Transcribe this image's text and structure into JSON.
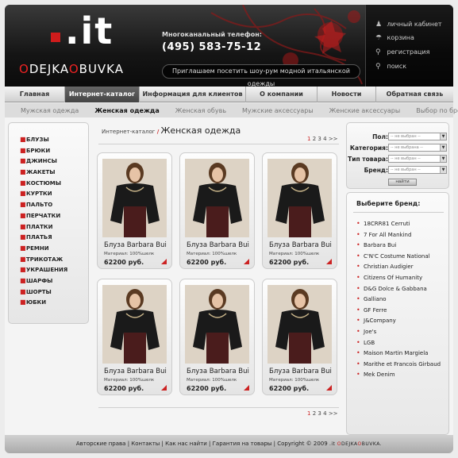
{
  "header": {
    "logo_mark": ".it",
    "logo_name_parts": [
      "",
      "O",
      "DEJKA",
      "O",
      "BUVKA"
    ],
    "phone_label": "Многоканальный телефон:",
    "phone": "(495) 583-75-12",
    "promo": "Приглашаем посетить шоу-рум модной итальянской одежды",
    "side_menu": [
      {
        "label": "личный кабинет",
        "icon": "users-icon"
      },
      {
        "label": "корзина",
        "icon": "basket-icon"
      },
      {
        "label": "регистрация",
        "icon": "key-icon"
      },
      {
        "label": "поиск",
        "icon": "search-icon"
      }
    ]
  },
  "main_nav": [
    {
      "label": "Главная",
      "active": false
    },
    {
      "label": "Интернет-каталог",
      "active": true
    },
    {
      "label": "Информация для клиентов",
      "active": false
    },
    {
      "label": "О компании",
      "active": false
    },
    {
      "label": "Новости",
      "active": false
    },
    {
      "label": "Обратная связь",
      "active": false
    }
  ],
  "sub_nav": [
    {
      "label": "Мужская одежда",
      "active": false
    },
    {
      "label": "Женская одежда",
      "active": true
    },
    {
      "label": "Женская обувь",
      "active": false
    },
    {
      "label": "Мужские аксессуары",
      "active": false
    },
    {
      "label": "Женские аксессуары",
      "active": false
    },
    {
      "label": "Выбор по бренду",
      "active": false
    }
  ],
  "categories": [
    "БЛУЗЫ",
    "БРЮКИ",
    "ДЖИНСЫ",
    "ЖАКЕТЫ",
    "КОСТЮМЫ",
    "КУРТКИ",
    "ПАЛЬТО",
    "ПЕРЧАТКИ",
    "ПЛАТКИ",
    "ПЛАТЬЯ",
    "РЕМНИ",
    "ТРИКОТАЖ",
    "УКРАШЕНИЯ",
    "ШАРФЫ",
    "ШОРТЫ",
    "ЮБКИ"
  ],
  "breadcrumb": {
    "root": "Интернет-каталог",
    "separator": "/",
    "title": "Женская одежда"
  },
  "pager": {
    "pages": [
      "1",
      "2",
      "3",
      "4"
    ],
    "current": "1",
    "next": ">>"
  },
  "products": [
    {
      "title": "Блуза Barbara Bui",
      "material": "Материал: 100%шелк",
      "price": "62200 руб."
    },
    {
      "title": "Блуза Barbara Bui",
      "material": "Материал: 100%шелк",
      "price": "62200 руб."
    },
    {
      "title": "Блуза Barbara Bui",
      "material": "Материал: 100%шелк",
      "price": "62200 руб."
    },
    {
      "title": "Блуза Barbara Bui",
      "material": "Материал: 100%шелк",
      "price": "62200 руб."
    },
    {
      "title": "Блуза Barbara Bui",
      "material": "Материал: 100%шелк",
      "price": "62200 руб."
    },
    {
      "title": "Блуза Barbara Bui",
      "material": "Материал: 100%шелк",
      "price": "62200 руб."
    }
  ],
  "filter": {
    "fields": [
      {
        "label": "Пол:",
        "value": "-- не выбран --"
      },
      {
        "label": "Категория:",
        "value": "-- не выбрана --"
      },
      {
        "label": "Тип товара:",
        "value": "-- не выбран --"
      },
      {
        "label": "Бренд:",
        "value": "-- не выбран --"
      }
    ],
    "button": "найти"
  },
  "brands": {
    "title": "Выберите бренд:",
    "items": [
      "18CRR81 Cerruti",
      "7 For All Mankind",
      "Barbara Bui",
      "C'N'C Costume National",
      "Christian Audigier",
      "Citizens Of Humanity",
      "D&G Dolce & Gabbana",
      "Galliano",
      "GF Ferre",
      "J&Company",
      "Joe's",
      "LGB",
      "Maison Martin Margiela",
      "Marithe et Francois Girbaud",
      "Mek Denim"
    ]
  },
  "footer": {
    "links": [
      "Авторские права",
      "Контакты",
      "Как нас найти",
      "Гарантия на товары"
    ],
    "copyright": "Copyright © 2009",
    "brand_parts": [
      ".it ",
      "O",
      "DEJKA",
      "O",
      "BUVKA."
    ]
  },
  "colors": {
    "accent": "#cc2222",
    "header_bg": "#1a1a1a",
    "nav_active": "#555555"
  }
}
